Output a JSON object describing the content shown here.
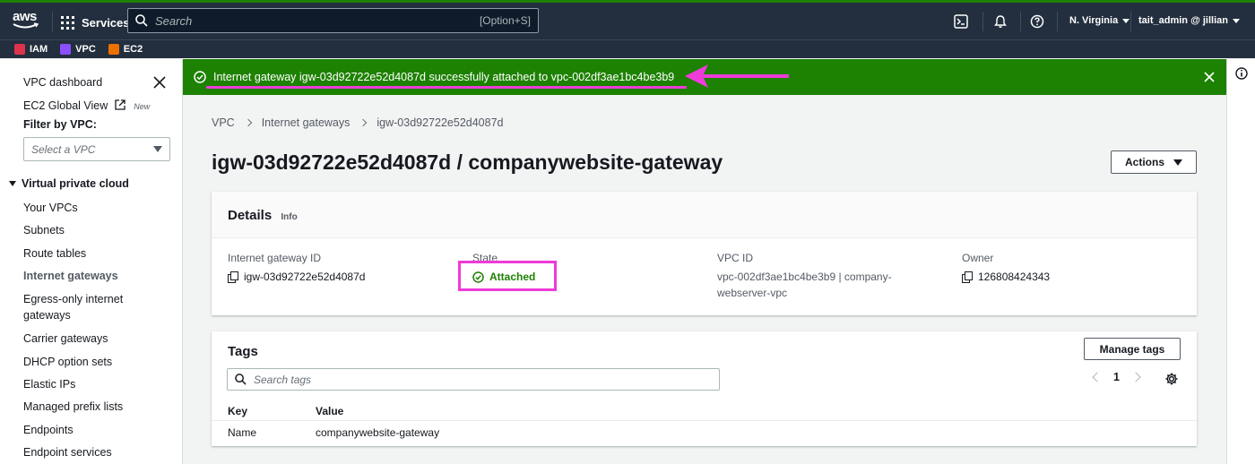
{
  "topnav": {
    "logo_text": "aws",
    "services_label": "Services",
    "search_placeholder": "Search",
    "search_shortcut": "[Option+S]",
    "region": "N. Virginia",
    "account": "tait_admin @ jillian",
    "icons": [
      "cloudshell-icon",
      "bell-icon",
      "help-icon"
    ]
  },
  "favorites": [
    {
      "label": "IAM",
      "color": "#dd344c"
    },
    {
      "label": "VPC",
      "color": "#8c4fff"
    },
    {
      "label": "EC2",
      "color": "#ed7100"
    }
  ],
  "flash": {
    "message": "Internet gateway igw-03d92722e52d4087d successfully attached to vpc-002df3ae1bc4be3b9",
    "color": "#1d8102",
    "annotation_color": "#ee3bd9"
  },
  "sidebar": {
    "dashboard": "VPC dashboard",
    "global_view": "EC2 Global View",
    "new_badge": "New",
    "filter_label": "Filter by VPC:",
    "filter_placeholder": "Select a VPC",
    "section": "Virtual private cloud",
    "items": [
      "Your VPCs",
      "Subnets",
      "Route tables",
      "Internet gateways",
      "Egress-only internet gateways",
      "Carrier gateways",
      "DHCP option sets",
      "Elastic IPs",
      "Managed prefix lists",
      "Endpoints",
      "Endpoint services"
    ],
    "active_item": "Internet gateways"
  },
  "breadcrumb": [
    "VPC",
    "Internet gateways",
    "igw-03d92722e52d4087d"
  ],
  "page": {
    "title": "igw-03d92722e52d4087d / companywebsite-gateway",
    "actions_label": "Actions"
  },
  "details": {
    "heading": "Details",
    "info": "Info",
    "gateway_id_label": "Internet gateway ID",
    "gateway_id": "igw-03d92722e52d4087d",
    "state_label": "State",
    "state": "Attached",
    "vpc_label": "VPC ID",
    "vpc_value_line1": "vpc-002df3ae1bc4be3b9 | company-",
    "vpc_value_line2": "webserver-vpc",
    "owner_label": "Owner",
    "owner": "126808424343"
  },
  "tags": {
    "heading": "Tags",
    "manage_label": "Manage tags",
    "search_placeholder": "Search tags",
    "page": "1",
    "columns": [
      "Key",
      "Value"
    ],
    "rows": [
      {
        "key": "Name",
        "value": "companywebsite-gateway"
      }
    ]
  }
}
